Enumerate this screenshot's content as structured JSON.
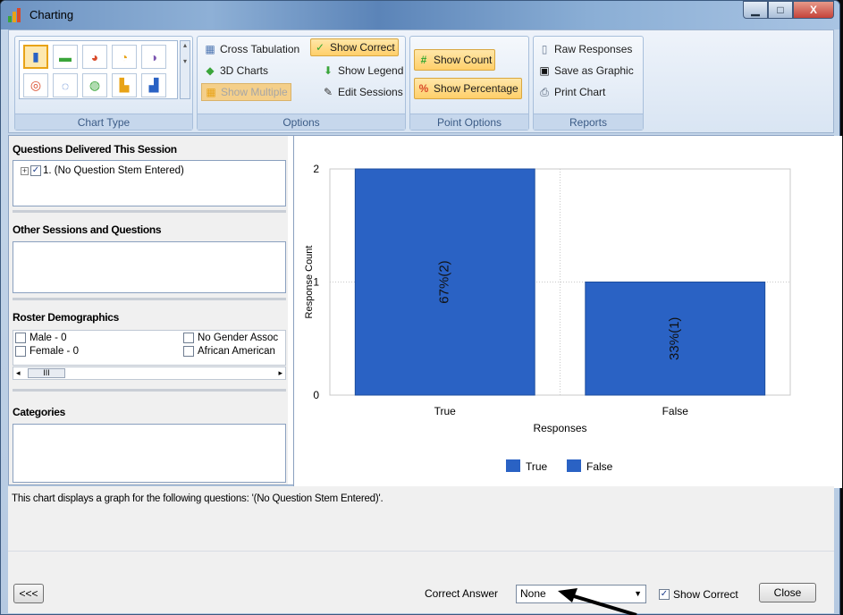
{
  "window": {
    "title": "Charting"
  },
  "ribbon": {
    "chart_type": {
      "label": "Chart Type",
      "icons": [
        "bar-chart-icon",
        "horizontal-bar-icon",
        "pie-chart-icon",
        "exploded-pie-icon",
        "pie-3d-icon",
        "doughnut-icon",
        "doughnut-exploded-icon",
        "doughnut-3d-icon",
        "stacked-bar-icon",
        "column-chart-icon"
      ]
    },
    "options": {
      "label": "Options",
      "cross_tabulation": "Cross Tabulation",
      "show_correct": "Show Correct",
      "charts_3d": "3D Charts",
      "show_legend": "Show Legend",
      "show_multiple": "Show Multiple",
      "edit_sessions": "Edit Sessions"
    },
    "point_options": {
      "label": "Point Options",
      "show_count": "Show Count",
      "show_percentage": "Show Percentage"
    },
    "reports": {
      "label": "Reports",
      "raw_responses": "Raw Responses",
      "save_as_graphic": "Save as Graphic",
      "print_chart": "Print Chart"
    }
  },
  "left": {
    "questions_title": "Questions Delivered This Session",
    "question_item": "1. (No Question Stem Entered)",
    "other_sessions_title": "Other Sessions and Questions",
    "roster_title": "Roster Demographics",
    "demographics": [
      "Male - 0",
      "Female - 0",
      "No Gender Assoc",
      "African American"
    ],
    "scroll_thumb": "III",
    "categories_title": "Categories"
  },
  "chart_data": {
    "type": "bar",
    "categories": [
      "True",
      "False"
    ],
    "values": [
      2,
      1
    ],
    "data_labels": [
      "67%(2)",
      "33%(1)"
    ],
    "xlabel": "Responses",
    "ylabel": "Response Count",
    "ylim": [
      0,
      2
    ],
    "yticks": [
      "0",
      "1",
      "2"
    ],
    "legend": [
      "True",
      "False"
    ],
    "legend_position": "bottom",
    "grid": true,
    "bar_color": "#2a62c4"
  },
  "description": "This chart displays a graph for the following questions: '(No Question Stem Entered)'.",
  "footer": {
    "back_button": "<<<",
    "correct_answer_label": "Correct Answer",
    "correct_answer_value": "None",
    "show_correct_label": "Show Correct",
    "show_correct_checked": true,
    "close_button": "Close"
  }
}
